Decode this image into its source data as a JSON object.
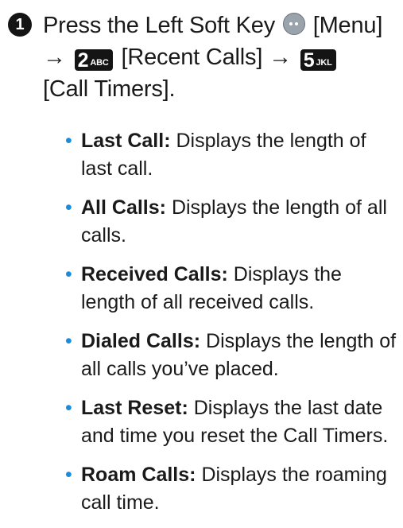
{
  "step": {
    "number": "1",
    "text_a": "Press the Left Soft Key",
    "text_b": "[Menu]",
    "arrow": "→",
    "key1_digit": "2",
    "key1_letters": "ABC",
    "text_c": "[Recent Calls]",
    "key2_digit": "5",
    "key2_letters": "JKL",
    "text_d": "[Call Timers]."
  },
  "bullet_glyph": "•",
  "items": [
    {
      "term": "Last Call:",
      "desc": "Displays the length of last call."
    },
    {
      "term": "All Calls:",
      "desc": "Displays the length of all calls."
    },
    {
      "term": "Received Calls:",
      "desc": "Displays the length of all received calls."
    },
    {
      "term": "Dialed Calls:",
      "desc": "Displays the length of all calls you’ve placed."
    },
    {
      "term": "Last Reset:",
      "desc": "Displays the last date and time you reset the Call Timers."
    },
    {
      "term": "Roam Calls:",
      "desc": "Displays the roaming call time."
    }
  ],
  "colors": {
    "bullet": "#1e8bd6",
    "key_bg": "#141414",
    "softkey": "#9aa3ab"
  }
}
